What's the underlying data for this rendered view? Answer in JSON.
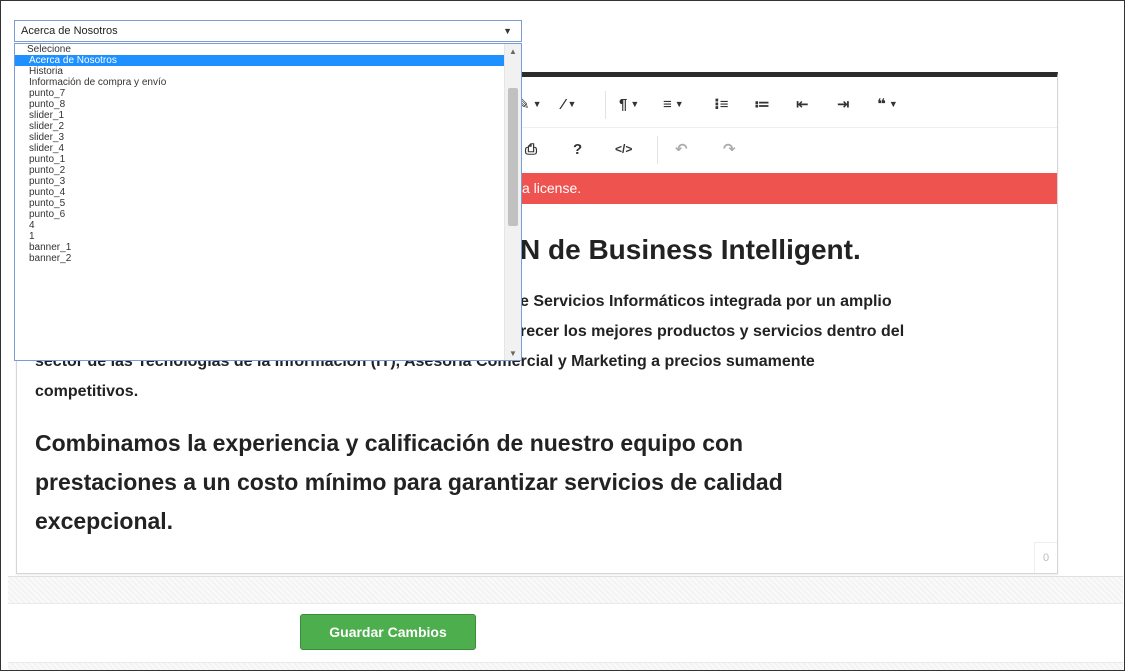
{
  "page_select": {
    "selected": "Acerca de Nosotros",
    "options": [
      "Selecione",
      "Acerca de Nosotros",
      "Historia",
      "Información de compra y envío",
      "punto_7",
      "punto_8",
      "slider_1",
      "slider_2",
      "slider_3",
      "slider_4",
      "punto_1",
      "punto_2",
      "punto_3",
      "punto_4",
      "punto_5",
      "punto_6",
      "4",
      "1",
      "banner_1",
      "banner_2"
    ],
    "highlighted_index": 1
  },
  "toolbar": {
    "row1": [
      {
        "name": "text-color-icon",
        "glyph": "✎",
        "caret": true
      },
      {
        "name": "clear-format-icon",
        "glyph": "⁄",
        "caret": true
      },
      {
        "name": "paragraph-format-icon",
        "glyph": "¶",
        "caret": true
      },
      {
        "name": "align-icon",
        "glyph": "≡",
        "caret": true
      },
      {
        "name": "ordered-list-icon",
        "glyph": "⁝≡",
        "caret": false
      },
      {
        "name": "unordered-list-icon",
        "glyph": "≔",
        "caret": false
      },
      {
        "name": "outdent-icon",
        "glyph": "⇤",
        "caret": false
      },
      {
        "name": "indent-icon",
        "glyph": "⇥",
        "caret": false
      },
      {
        "name": "quote-icon",
        "glyph": "❝",
        "caret": true
      }
    ],
    "row2": [
      {
        "name": "print-icon",
        "glyph": "⎙"
      },
      {
        "name": "help-icon",
        "glyph": "?"
      },
      {
        "name": "code-view-icon",
        "glyph": "</>"
      },
      {
        "name": "undo-icon",
        "glyph": "↶"
      },
      {
        "name": "redo-icon",
        "glyph": "↷"
      }
    ]
  },
  "license_banner": "a license.",
  "content": {
    "heading1": "N de Business Intelligent.",
    "para_lines": [
      "e Servicios Informáticos integrada por un amplio",
      "recer los mejores productos y servicios dentro del",
      "sector de las Tecnologías de la Información (IT), Asesoría Comercial y Marketing a precios sumamente",
      "competitivos."
    ],
    "heading2_lines": [
      "Combinamos la experiencia y calificación de nuestro equipo con",
      "prestaciones a un costo mínimo para garantizar servicios de calidad",
      "excepcional."
    ]
  },
  "char_counter": "0",
  "save_button": "Guardar Cambios",
  "colors": {
    "license_red": "#ef5350",
    "save_green": "#4cae4c",
    "select_highlight": "#1e90ff"
  }
}
